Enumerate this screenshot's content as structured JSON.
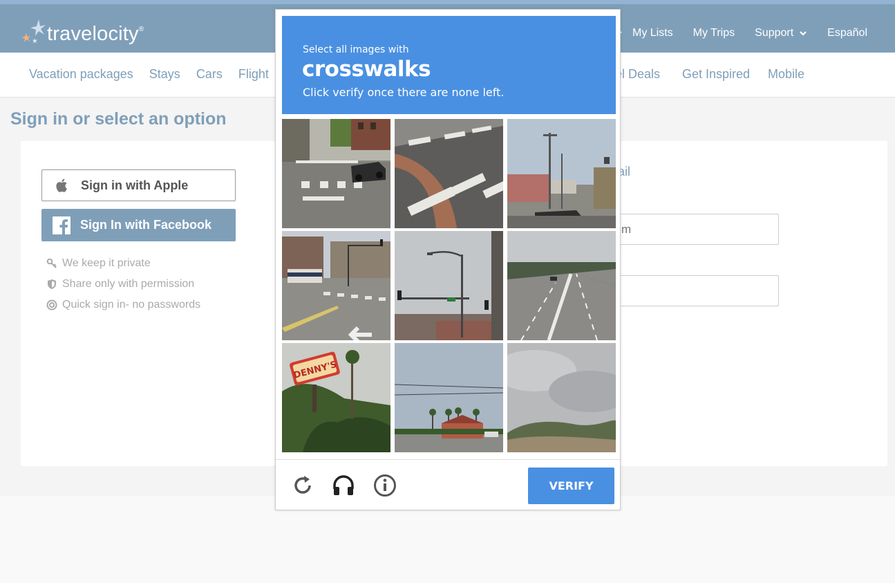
{
  "brand": {
    "name": "travelocity",
    "trademark": "®"
  },
  "topnav": {
    "items": [
      "My Lists",
      "My Trips",
      "Support",
      "Español"
    ]
  },
  "subnav": {
    "left": [
      "Vacation packages",
      "Stays",
      "Cars",
      "Flight"
    ],
    "deals": "el Deals",
    "inspired": "Get Inspired",
    "mobile": "Mobile"
  },
  "page": {
    "title": "Sign in or select an option"
  },
  "signin": {
    "apple_label": "Sign in with Apple",
    "facebook_label": "Sign In with Facebook",
    "perks": [
      "We keep it private",
      "Share only with permission",
      "Quick sign in- no passwords"
    ],
    "email_label_partial": "ail",
    "email_placeholder_partial": "m"
  },
  "captcha": {
    "line1": "Select all images with",
    "target": "crosswalks",
    "line3": "Click verify once there are none left.",
    "verify_label": "VERIFY",
    "tiles": [
      "street-corner-crosswalk-car",
      "crosswalk-closeup",
      "street-lamps-plaza",
      "intersection-traffic-lights-bus",
      "street-light-traffic-signal",
      "highway-road",
      "dennys-sign-trees",
      "restaurant-palm-trees",
      "cloudy-sky-hill"
    ],
    "footer_icons": [
      "reload-icon",
      "audio-headphones-icon",
      "info-icon"
    ]
  },
  "colors": {
    "brand_blue": "#7f9fb9",
    "captcha_blue": "#4a90e2"
  }
}
